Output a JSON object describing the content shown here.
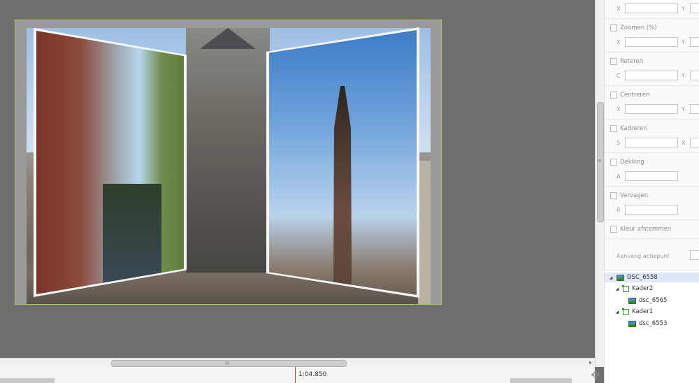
{
  "panel": {
    "top_fields": {
      "x_label": "X",
      "y_label": "Y"
    },
    "sections": [
      {
        "id": "zoomen",
        "label": "Zoomen  (%)",
        "checked": false,
        "f1": "X",
        "f2": "Y"
      },
      {
        "id": "roteren",
        "label": "Roteren",
        "checked": false,
        "f1": "C",
        "f2": "Y"
      },
      {
        "id": "centreren",
        "label": "Centreren",
        "checked": false,
        "f1": "X",
        "f2": "Y"
      },
      {
        "id": "kadreren",
        "label": "Kadreren",
        "checked": false,
        "f1": "S",
        "f2": "X"
      },
      {
        "id": "dekking",
        "label": "Dekking",
        "checked": false,
        "f1": "A"
      },
      {
        "id": "vervagen",
        "label": "Vervagen",
        "checked": false,
        "f1": "R"
      },
      {
        "id": "kleur",
        "label": "Kleur afstemmen",
        "checked": false
      }
    ],
    "aanvang_label": "Aanvang actiepunt"
  },
  "tree": {
    "items": [
      {
        "label": "DSC_6558",
        "level": 0,
        "type": "image",
        "expanded": true,
        "selected": true
      },
      {
        "label": "Kader2",
        "level": 1,
        "type": "frame",
        "expanded": true
      },
      {
        "label": "dsc_6565",
        "level": 2,
        "type": "image"
      },
      {
        "label": "Kader1",
        "level": 1,
        "type": "frame",
        "expanded": true
      },
      {
        "label": "dsc_6553",
        "level": 2,
        "type": "image"
      }
    ]
  },
  "timeline": {
    "time": "1:04.850"
  },
  "scroll": {
    "grip": "III",
    "vgrip": "≡",
    "right_arrow": "▸"
  },
  "colors": {
    "preview_border": "#a8c66a",
    "time_marker": "#d23b3b",
    "selection": "#dfe8f6"
  },
  "icons": {
    "move": "move-icon",
    "image": "image-icon",
    "frame": "frame-icon"
  }
}
